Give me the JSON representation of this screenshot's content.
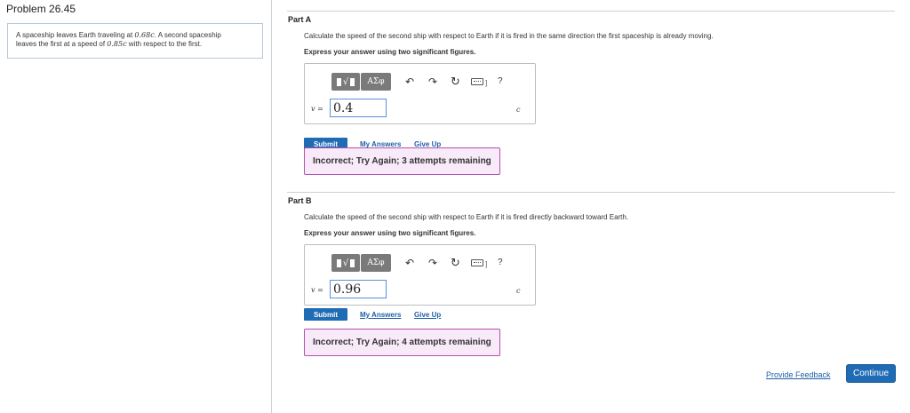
{
  "problem": {
    "title": "Problem 26.45",
    "statement_line1_a": "A spaceship leaves Earth traveling at ",
    "statement_line1_math": "0.68c",
    "statement_line1_b": ". A second spaceship",
    "statement_line2_a": "leaves the first at a speed of ",
    "statement_line2_math": "0.85c",
    "statement_line2_b": " with respect to the first."
  },
  "toolbar": {
    "templates_glyph": "√",
    "symbols_label": "ΑΣφ",
    "undo_glyph": "↶",
    "redo_glyph": "↷",
    "reset_glyph": "↻",
    "kb_bracket": "]",
    "help_label": "?"
  },
  "parts": [
    {
      "title": "Part A",
      "question": "Calculate the speed of the second ship with respect to Earth if it is fired in the same direction the first spaceship is already moving.",
      "instructions": "Express your answer using two significant figures.",
      "var": "v",
      "equals": " =",
      "answer_value": "0.4",
      "unit": "c",
      "submit_label": "Submit",
      "my_answers_label": "My Answers",
      "give_up_label": "Give Up",
      "feedback": "Incorrect; Try Again; 3 attempts remaining"
    },
    {
      "title": "Part B",
      "question": "Calculate the speed of the second ship with respect to Earth if it is fired directly backward toward Earth.",
      "instructions": "Express your answer using two significant figures.",
      "var": "v",
      "equals": " =",
      "answer_value": "0.96",
      "unit": "c",
      "submit_label": "Submit",
      "my_answers_label": "My Answers",
      "give_up_label": "Give Up",
      "feedback": "Incorrect; Try Again; 4 attempts remaining"
    }
  ],
  "footer": {
    "provide_feedback_label": "Provide Feedback",
    "continue_label": "Continue"
  },
  "colors": {
    "primary_button": "#1f6cb4",
    "link": "#1f5fa8",
    "feedback_bg": "#f8eaf8",
    "feedback_border": "#b34fb0",
    "input_border": "#5b8fd9"
  }
}
